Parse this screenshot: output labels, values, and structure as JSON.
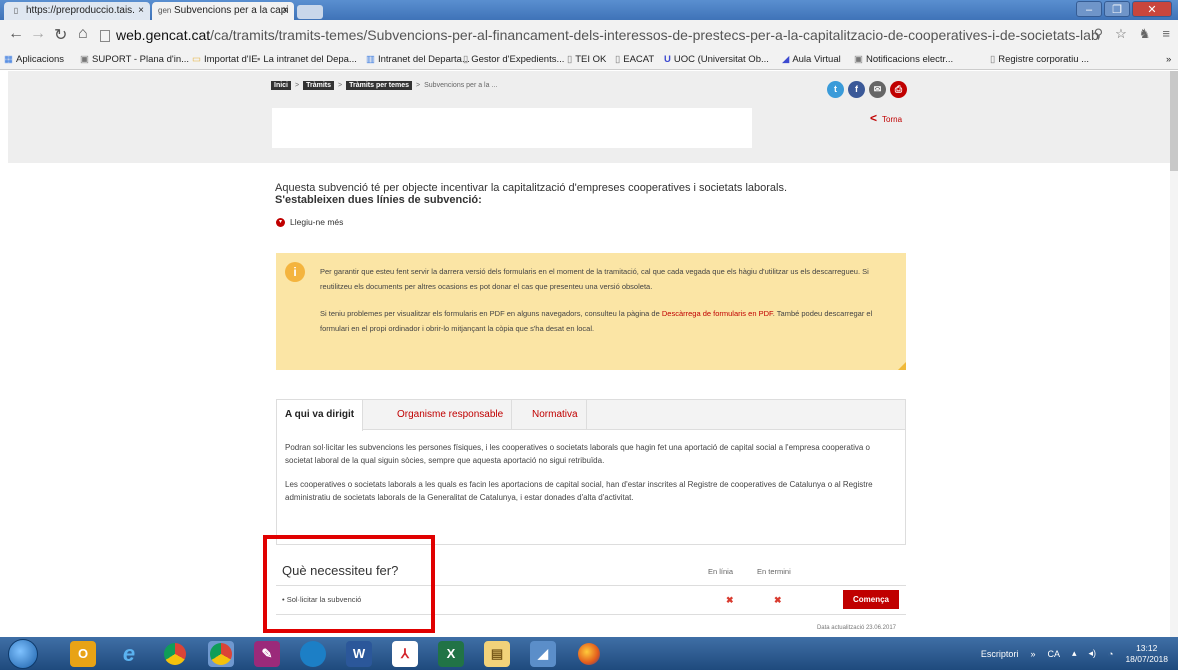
{
  "browser": {
    "tabs": [
      {
        "label": "https://preproduccio.tais.",
        "favicon": "page-icon"
      },
      {
        "label": "Subvencions per a la capi",
        "favicon": "gencat-icon"
      }
    ],
    "url_host": "web.gencat.cat",
    "url_path": "/ca/tramits/tramits-temes/Subvencions-per-al-financament-dels-interessos-de-prestecs-per-a-la-capitalitzacio-de-cooperatives-i-de-societats-laborals",
    "bookmarks": [
      "Aplicacions",
      "SUPORT - Plana d'in...",
      "Importat d'IE",
      "La intranet del Depa...",
      "Intranet del Departa...",
      "Gestor d'Expedients...",
      "TEI OK",
      "EACAT",
      "UOC (Universitat Ob...",
      "Aula Virtual",
      "Notificacions electr...",
      "Registre corporatiu ..."
    ]
  },
  "page": {
    "breadcrumb": [
      "Inici",
      "Tràmits",
      "Tràmits per temes",
      "Subvencions per a la ..."
    ],
    "back_label": "Torna",
    "intro_line1": "Aquesta subvenció té per objecte incentivar la capitalització d'empreses cooperatives i societats laborals.",
    "intro_line2": "S'estableixen dues línies de subvenció:",
    "read_more": "Llegiu-ne més",
    "notice": {
      "p1": "Per garantir que esteu fent servir la darrera versió dels formularis en el moment de la tramitació, cal que cada vegada que els hàgiu d'utilitzar us els descarregueu. Si reutilitzeu els documents per altres ocasions es pot donar el cas que presenteu una versió obsoleta.",
      "p2_start": "Si teniu problemes per visualitzar els formularis en PDF en alguns navegadors, consulteu la pàgina de ",
      "p2_link": "Descàrrega de formularis en PDF",
      "p2_end": ". També podeu descarregar el formulari en el propi ordinador i obrir-lo mitjançant la còpia que s'ha desat en local."
    },
    "tabs": [
      "A qui va dirigit",
      "Organisme responsable",
      "Normativa"
    ],
    "tab_body_p1": "Podran sol·licitar les subvencions les persones físiques, i les cooperatives o societats laborals que hagin fet una aportació de capital social a l'empresa cooperativa o societat laboral de la qual siguin sòcies, sempre que aquesta aportació no sigui retribuïda.",
    "tab_body_p2": "Les cooperatives o societats laborals a les quals es facin les aportacions de capital social, han d'estar inscrites al Registre de cooperatives de Catalunya o al Registre administratiu de societats laborals de la Generalitat de Catalunya, i estar donades d'alta d'activitat.",
    "need_title": "Què necessiteu fer?",
    "col_online": "En línia",
    "col_deadline": "En termini",
    "action_label": "• Sol·licitar la subvenció",
    "start_button": "Comença",
    "updated": "Data actualització 23.06.2017"
  },
  "taskbar": {
    "desktop_label": "Escriptori",
    "lang": "CA",
    "time": "13:12",
    "date": "18/07/2018"
  },
  "colors": {
    "accent_red": "#c00000",
    "notice_bg": "#fbe5a5",
    "highlight_box": "#e00000"
  }
}
